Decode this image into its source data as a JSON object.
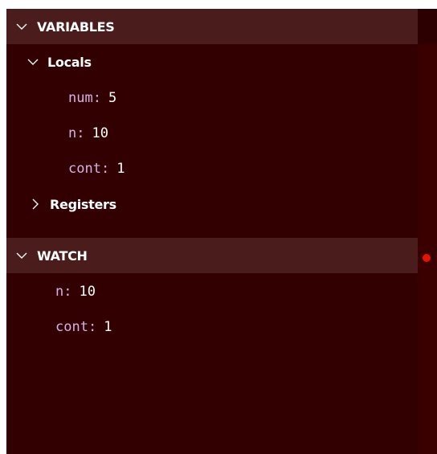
{
  "variables": {
    "title": "VARIABLES",
    "locals": {
      "label": "Locals",
      "items": [
        {
          "name": "num",
          "value": "5"
        },
        {
          "name": "n",
          "value": "10"
        },
        {
          "name": "cont",
          "value": "1"
        }
      ]
    },
    "registers": {
      "label": "Registers"
    }
  },
  "watch": {
    "title": "WATCH",
    "items": [
      {
        "name": "n",
        "value": "10"
      },
      {
        "name": "cont",
        "value": "1"
      }
    ]
  },
  "colors": {
    "panel_bg": "#320000",
    "header_bg": "#4a1c1c",
    "var_name": "#d6b0e6",
    "breakpoint": "#e51400"
  },
  "icons": {
    "expanded": "chevron-down-icon",
    "collapsed": "chevron-right-icon"
  }
}
